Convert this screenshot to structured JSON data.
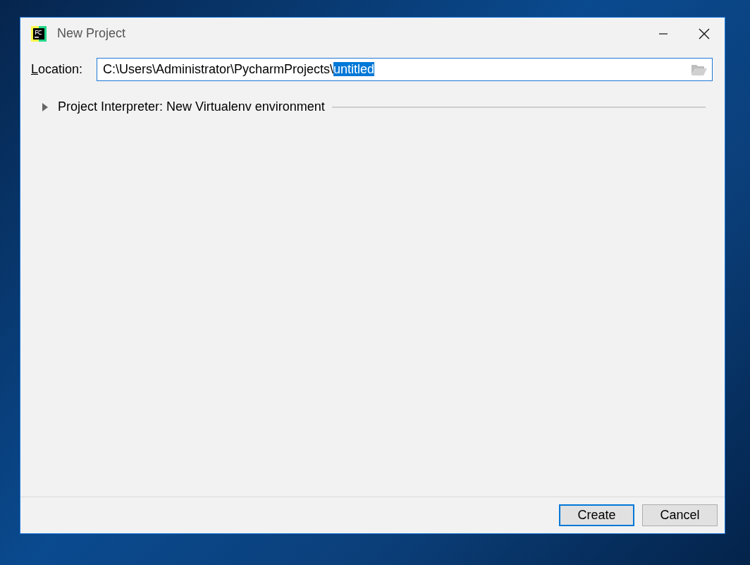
{
  "window": {
    "title": "New Project",
    "controls": [
      {
        "kind": "minimize"
      },
      {
        "kind": "close"
      }
    ]
  },
  "location": {
    "label_parts": [
      {
        "text": "L",
        "underlined": true
      },
      {
        "text": "ocation:",
        "underlined": false
      }
    ],
    "value_parts": [
      {
        "text": "C:\\Users\\Administrator\\PycharmProjects\\",
        "selected": false
      },
      {
        "text": "untitled",
        "selected": true
      }
    ]
  },
  "interpreter_section": {
    "title": "Project Interpreter: New Virtualenv environment",
    "expanded": false
  },
  "buttons": [
    {
      "label": "Create",
      "default": true
    },
    {
      "label": "Cancel",
      "default": false
    }
  ]
}
